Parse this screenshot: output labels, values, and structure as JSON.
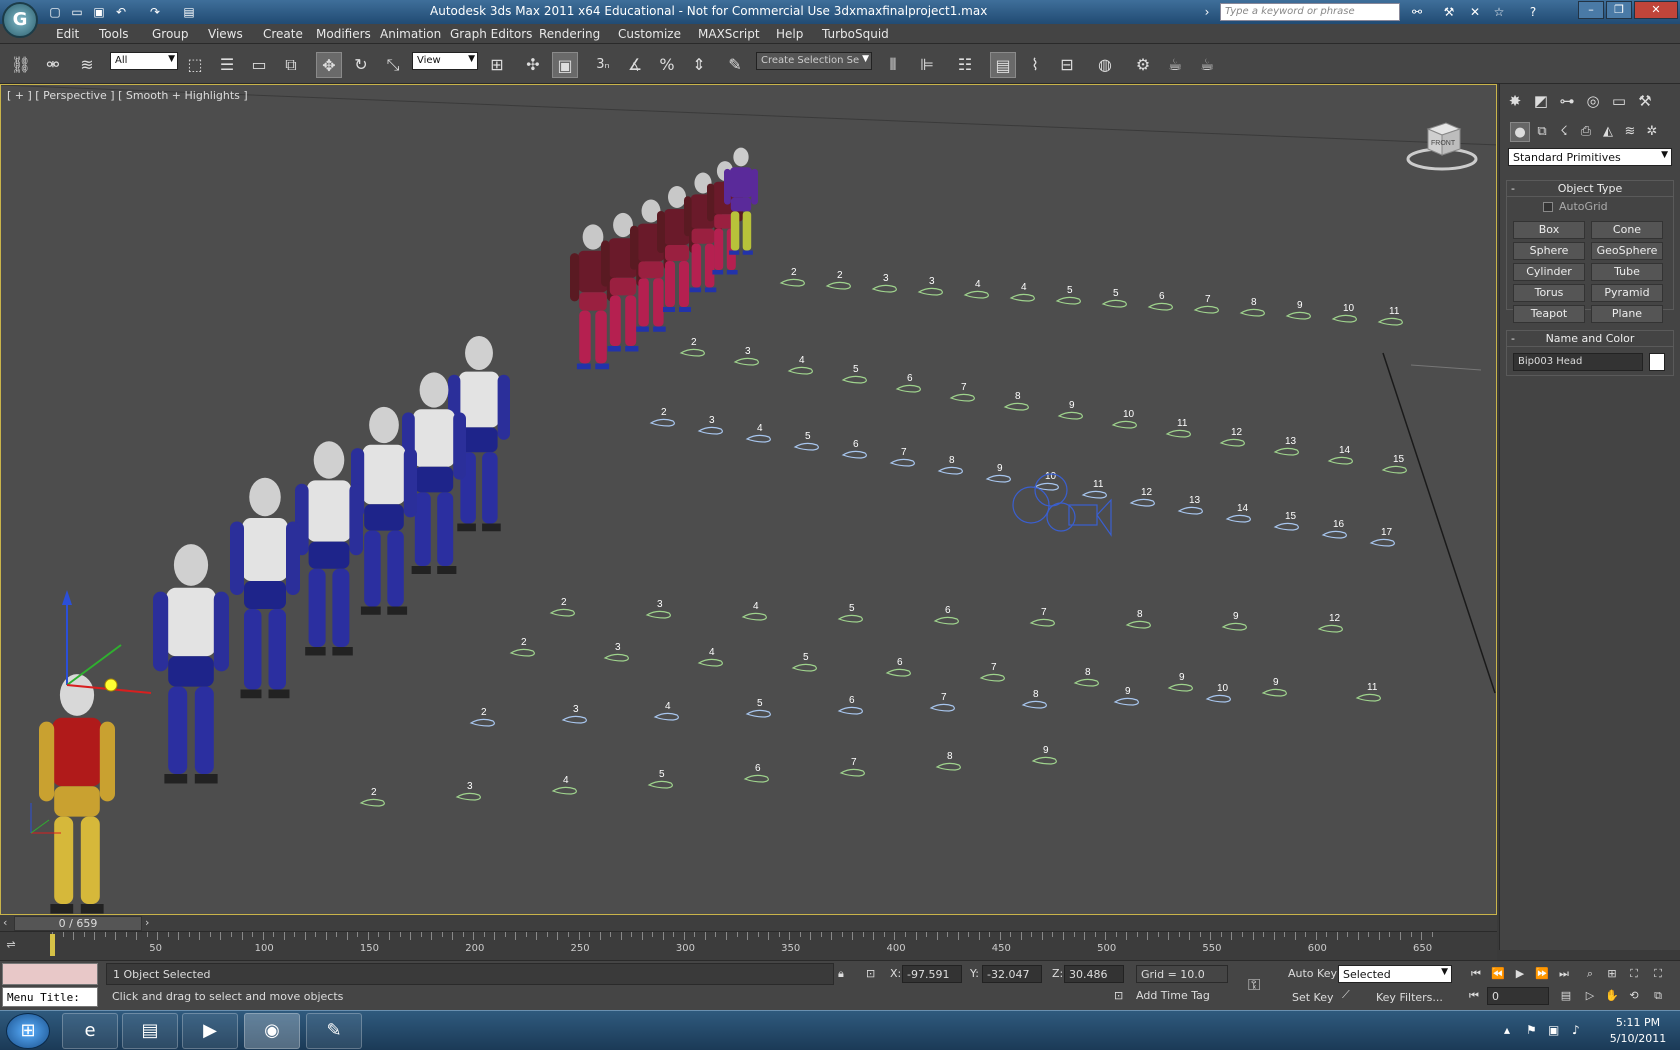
{
  "titlebar": {
    "app_logo": "G",
    "title": "Autodesk 3ds Max  2011 x64    Educational - Not for Commercial Use    3dxmaxfinalproject1.max",
    "search_placeholder": "Type a keyword or phrase",
    "icons": [
      "new-icon",
      "open-icon",
      "save-icon",
      "undo-icon",
      "redo-icon",
      "project-icon",
      "binoculars-icon",
      "tools-icon",
      "close-x-icon",
      "star-icon",
      "help-icon"
    ]
  },
  "menu": [
    "Edit",
    "Tools",
    "Group",
    "Views",
    "Create",
    "Modifiers",
    "Animation",
    "Graph Editors",
    "Rendering",
    "Customize",
    "MAXScript",
    "Help",
    "TurboSquid"
  ],
  "toolbar": {
    "selection_filter": "All",
    "reference_coord": "View",
    "named_selection": "Create Selection Se",
    "snap_label": "3"
  },
  "viewport": {
    "label": "[ + ] [ Perspective ] [ Smooth + Highlights ]",
    "viewcube_label": "FRONT"
  },
  "command_panel": {
    "category": "Standard Primitives",
    "object_type_title": "Object Type",
    "autogrid_label": "AutoGrid",
    "primitives": [
      "Box",
      "Cone",
      "Sphere",
      "GeoSphere",
      "Cylinder",
      "Tube",
      "Torus",
      "Pyramid",
      "Teapot",
      "Plane"
    ],
    "name_color_title": "Name and Color",
    "object_name": "Bip003 Head",
    "object_color": "#ffffff"
  },
  "timeline": {
    "frame_display": "0 / 659",
    "ticks": [
      "50",
      "100",
      "150",
      "200",
      "250",
      "300",
      "350",
      "400",
      "450",
      "500",
      "550",
      "600",
      "650"
    ]
  },
  "status": {
    "menu_title": "Menu Title:",
    "selection_count": "1 Object Selected",
    "prompt": "Click and drag to select and move objects",
    "x_label": "X:",
    "x_value": "-97.591",
    "y_label": "Y:",
    "y_value": "-32.047",
    "z_label": "Z:",
    "z_value": "30.486",
    "grid": "Grid = 10.0",
    "add_time_tag": "Add Time Tag",
    "auto_key": "Auto Key",
    "set_key": "Set Key",
    "key_mode": "Selected",
    "key_filters": "Key Filters...",
    "current_frame": "0"
  },
  "taskbar": {
    "time": "5:11 PM",
    "date": "5/10/2011"
  },
  "footprints": {
    "row1": [
      "2",
      "2",
      "3",
      "3",
      "4",
      "4",
      "5",
      "5",
      "6",
      "7",
      "8",
      "9",
      "10",
      "11"
    ],
    "row2": [
      "2",
      "3",
      "4",
      "5",
      "6",
      "7",
      "8",
      "9",
      "10",
      "11",
      "12",
      "13",
      "14",
      "15"
    ],
    "row3": [
      "2",
      "3",
      "4",
      "5",
      "6",
      "7",
      "8",
      "9",
      "10",
      "11",
      "12",
      "13",
      "14",
      "15",
      "16",
      "17"
    ],
    "row4": [
      "2",
      "3",
      "4",
      "5",
      "6",
      "7",
      "8",
      "9",
      "12"
    ],
    "row5": [
      "2",
      "3",
      "4",
      "5",
      "6",
      "7",
      "8",
      "9",
      "9",
      "11"
    ],
    "row6": [
      "2",
      "3",
      "4",
      "5",
      "6",
      "7",
      "8",
      "9",
      "10"
    ],
    "row7": [
      "2",
      "3",
      "4",
      "5",
      "6",
      "7",
      "8",
      "9"
    ]
  }
}
